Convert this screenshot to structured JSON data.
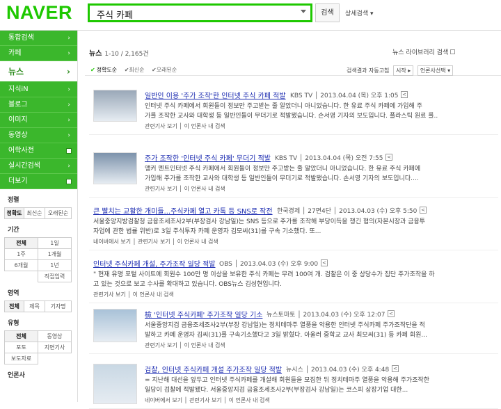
{
  "header": {
    "logo": "NAVER",
    "query": "주식 카페",
    "search_btn": "검색",
    "advanced": "상세검색 ▾"
  },
  "sidebar": {
    "top": [
      {
        "label": "통합검색",
        "ar": "›"
      },
      {
        "label": "카페",
        "ar": "›"
      }
    ],
    "selected": {
      "label": "뉴스",
      "ar": "›"
    },
    "bottom": [
      {
        "label": "지식iN",
        "ar": "›"
      },
      {
        "label": "블로그",
        "ar": "›"
      },
      {
        "label": "이미지",
        "ar": "›"
      },
      {
        "label": "동영상",
        "ar": "›"
      },
      {
        "label": "어학사전",
        "ar": ""
      },
      {
        "label": "실시간검색",
        "ar": "›"
      },
      {
        "label": "더보기",
        "ar": ""
      }
    ],
    "sort_title": "정렬",
    "sort_opts": [
      "정확도",
      "최신순",
      "오래된순"
    ],
    "period_title": "기간",
    "period_rows": [
      [
        "전체",
        "1일"
      ],
      [
        "1주",
        "1개월"
      ],
      [
        "6개월",
        "1년"
      ]
    ],
    "period_input": "직접입력",
    "area_title": "영역",
    "area_opts": [
      "전체",
      "제목",
      "기자명"
    ],
    "type_title": "유형",
    "type_rows": [
      [
        "전체",
        "동영상"
      ],
      [
        "포토",
        "지면기사"
      ],
      [
        "보도자료",
        ""
      ]
    ],
    "press_title": "언론사"
  },
  "main": {
    "heading": "뉴스",
    "count": "1-10 / 2,165건",
    "library": "뉴스 라이브러리 검색",
    "sort": {
      "accuracy": "정확도순",
      "latest": "최신순",
      "oldest": "오래된순"
    },
    "auto": "검색결과 자동고침",
    "start": "시작 ▸",
    "press_select": "언론사선택 ▾",
    "items": [
      {
        "title": "일반인 이용 '주가 조작'한 인터넷 주식 카페 적발",
        "meta": "KBS TV │ 2013.04.04 (목) 오후 1:05",
        "body1": "인터넷 주식 카페에서 회원들이 정보만 주고받는 줄 알았더니 아니었습니다. 한 유료 주식 카페에 가입해 주",
        "body2": "가를 조작한 교사와 대학생 등 일반인들이 무더기로 적발됐습니다. 손서영 기자의 보도입니다. 플라스틱 원료 를..",
        "foot": "관련기사 보기 │ 이 언론사 내 검색"
      },
      {
        "title": "주가 조작한 '인터넷 주식 카페' 무더기 적발",
        "meta": "KBS TV │ 2013.04.04 (목) 오전 7:55",
        "body1": "앵커 멘트인터넷 주식 카페에서 회원들이 정보만 주고받는 줄 알았더니 아니었습니다. 한 유료 주식 카페에",
        "body2": "가입해 주가를 조작한 교사와 대학생 등 일반인들이 무더기로 적발됐습니다. 손서영 기자의 보도입니다....",
        "foot": "관련기사 보기 │ 이 언론사 내 검색"
      },
      {
        "title": "큰 빨치는 교활한 개미들...주식카페 열고 카톡 등 SNS로 작전",
        "meta": "한국경제 │ 27면4단 │ 2013.04.03 (수) 오후 5:50",
        "body1": "서울중앙지방검찰청 금융조세조사2부(부장검사 강남일)는 SNS 등으로 주가를 조작해 부당이득을 챙긴 혐의(자본시장과 금융투",
        "body2": "자업에 관한 법률 위반)로 3일 주식투자 카페 운영자 김모씨(31)를 구속 기소했다. 또...",
        "foot": "네이버에서 보기 │ 관련기사 보기 │ 이 언론사 내 검색"
      },
      {
        "title": "인터넷 주식카페 개설, 주가조작 일당 적발",
        "meta": "OBS │ 2013.04.03 (수) 오후 9:00",
        "body1": "\" 현재 유명 포털 사이트에 회원수 100만 명 이상을 보유한 주식 카페는 무려 100여 개. 검찰은 이 중 상당수가 집단 주가조작을 하",
        "body2": "고 있는 것으로 보고 수사를 확대하고 있습니다. OBS뉴스 김성현입니다.",
        "foot": "관련기사 보기 │ 이 언론사 내 검색"
      },
      {
        "title": "檢 '인터넷 주식카페' 주가조작 일당 기소",
        "meta": "뉴스토마토 │ 2013.04.03 (수) 오후 12:07",
        "body1": "서울중앙지검 금융조세조사2부(부장 강남일)는 정치테마주 열풍을 악용한 인터넷 주식카페 주가조작단을 적",
        "body2": "발하고 카페 운영자 김씨(31)를 구속기소했다고 3일 밝혔다. 아울러 중학교 교사 최모씨(31) 등 카페 회원...",
        "foot": "관련기사 보기 │ 이 언론사 내 검색"
      },
      {
        "title": "검찰, 인터넷 주식카페 개설 주가조작 일당 적발",
        "meta": "뉴시스 │ 2013.04.03 (수) 오후 4:48",
        "body1": "= 지난해 대선을 앞두고 인터넷 주식카페를 개설해 회원들을 모집한 뒤 정치테마주 열풍을 악용해 주가조작한",
        "body2": "일당이 검찰에 적발됐다. 서울중앙지검 금융조세조사2부(부장검사 강남일)는 코스피 상장기업 대한...",
        "foot": "네이버에서 보기 │ 관련기사 보기 │ 이 언론사 내 검색"
      }
    ]
  }
}
